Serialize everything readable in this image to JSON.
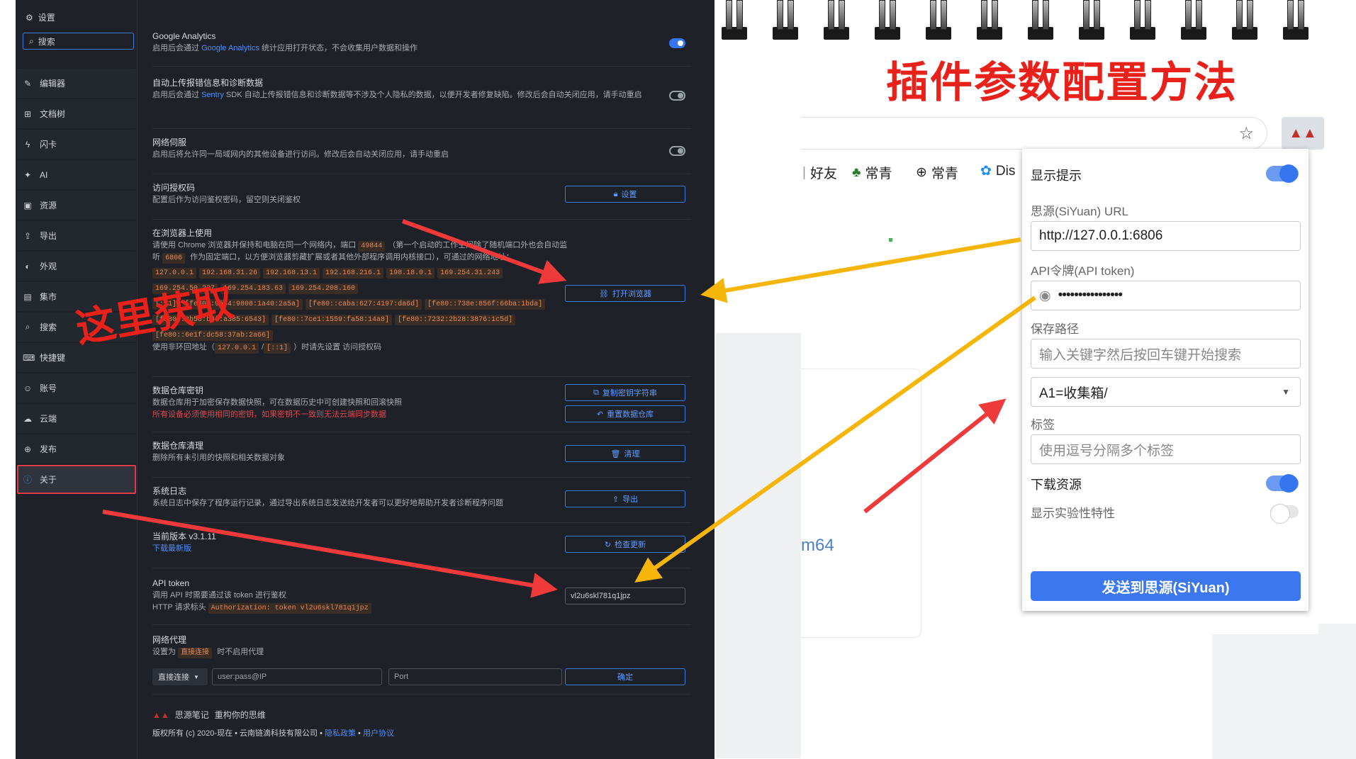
{
  "sidebar": {
    "title": "设置",
    "search_placeholder": "搜索",
    "items": [
      {
        "label": "编辑器",
        "icon": "pencil-icon"
      },
      {
        "label": "文档树",
        "icon": "tree-icon"
      },
      {
        "label": "闪卡",
        "icon": "bolt-icon"
      },
      {
        "label": "AI",
        "icon": "sparkle-icon"
      },
      {
        "label": "资源",
        "icon": "image-icon"
      },
      {
        "label": "导出",
        "icon": "upload-icon"
      },
      {
        "label": "外观",
        "icon": "palette-icon"
      },
      {
        "label": "集市",
        "icon": "store-icon"
      },
      {
        "label": "搜索",
        "icon": "search-icon"
      },
      {
        "label": "快捷键",
        "icon": "keyboard-icon"
      },
      {
        "label": "账号",
        "icon": "user-icon"
      },
      {
        "label": "云端",
        "icon": "cloud-icon"
      },
      {
        "label": "发布",
        "icon": "globe-icon"
      },
      {
        "label": "关于",
        "icon": "info-icon",
        "active": true
      }
    ]
  },
  "settings": {
    "analytics": {
      "title": "Google Analytics",
      "desc_a": "启用后会通过 ",
      "desc_link": "Google Analytics",
      "desc_b": " 统计应用打开状态，不会收集用户数据和操作",
      "enabled": true
    },
    "diagnostics": {
      "title": "自动上传报错信息和诊断数据",
      "desc_a": "启用后会通过 ",
      "desc_link": "Sentry",
      "desc_b": " SDK 自动上传报错信息和诊断数据等不涉及个人隐私的数据，以便开发者修复缺陷。修改后会自动关闭应用，请手动重启",
      "enabled": false
    },
    "network_serve": {
      "title": "网络伺服",
      "desc": "启用后将允许同一局域网内的其他设备进行访问。修改后会自动关闭应用，请手动重启",
      "enabled": false
    },
    "access_code": {
      "title": "访问授权码",
      "desc": "配置后作为访问鉴权密码，留空则关闭鉴权",
      "button": "设置"
    },
    "browser": {
      "title": "在浏览器上使用",
      "desc_a": "请使用 Chrome 浏览器并保持和电脑在同一个网络内，端口 ",
      "port_random": "49844",
      "desc_b": "（第一个启动的工作空间除了随机端口外也会自动监听 ",
      "port_fixed": "6806",
      "desc_c": " 作为固定端口，以方便浏览器剪藏扩展或者其他外部程序调用内核接口），可通过的网络地址：",
      "ips_line1": [
        "127.0.0.1",
        "192.168.31.26",
        "192.168.13.1",
        "192.168.216.1",
        "198.18.0.1",
        "169.254.31.243"
      ],
      "ips_line2": [
        "169.254.50.227",
        "169.254.183.63",
        "169.254.208.160"
      ],
      "ips_line3": [
        "[::1]",
        "[fe80::9564:9808:1a40:2a5a]",
        "[fe80::caba:627:4197:da6d]",
        "[fe80::738e:856f:66ba:1bda]"
      ],
      "ips_line4": [
        "[fe80::8b58:b4f:a385:6543]",
        "[fe80::7ce1:1559:fa58:14a8]",
        "[fe80::7232:2b28:3876:1c5d]"
      ],
      "ips_line5": [
        "[fe80::6e1f:dc58:37ab:2a66]"
      ],
      "loop_a": "使用非环回地址（",
      "loop_ip1": "127.0.0.1",
      "loop_sep": "/",
      "loop_ip2": "[::1]",
      "loop_b": "）时请先设置 访问授权码",
      "button": "打开浏览器"
    },
    "repo_key": {
      "title": "数据仓库密钥",
      "desc": "数据仓库用于加密保存数据快照，可在数据历史中可创建快照和回滚快照",
      "warn": "所有设备必须使用相同的密钥，如果密钥不一致则无法云端同步数据",
      "button1": "复制密钥字符串",
      "button2": "重置数据仓库"
    },
    "repo_clean": {
      "title": "数据仓库清理",
      "desc": "删除所有未引用的快照和相关数据对象",
      "button": "清理"
    },
    "syslog": {
      "title": "系统日志",
      "desc": "系统日志中保存了程序运行记录，通过导出系统日志发送给开发者可以更好地帮助开发者诊断程序问题",
      "button": "导出"
    },
    "version": {
      "title": "当前版本 v3.1.11",
      "link": "下载最新版",
      "button": "检查更新"
    },
    "api_token": {
      "title": "API token",
      "desc": "调用 API 时需要通过该 token 进行鉴权",
      "header_label": "HTTP 请求标头 ",
      "header_value": "Authorization: token vl2u6skl781q1jpz",
      "value": "vl2u6skl781q1jpz"
    },
    "proxy": {
      "title": "网络代理",
      "desc_a": "设置为 ",
      "desc_chip": "直接连接",
      "desc_b": " 时不启用代理",
      "select": "直接连接",
      "user_placeholder": "user:pass@IP",
      "port_placeholder": "Port",
      "button": "确定"
    },
    "footer": {
      "brand": "思源笔记",
      "slogan": "重构你的思维",
      "copyright": "版权所有 (c) 2020-现在 • 云南链滴科技有限公司 • ",
      "privacy": "隐私政策",
      "dot": " • ",
      "agreement": "用户协议"
    }
  },
  "right": {
    "title": "插件参数配置方法",
    "annotation": "这里获取",
    "bookmarks": [
      {
        "label": "好友",
        "icon": "separator-icon"
      },
      {
        "label": "常青",
        "icon": "tree-figure-icon"
      },
      {
        "label": "常青",
        "icon": "globe-icon"
      },
      {
        "label": "Dis",
        "icon": "butterfly-icon"
      }
    ],
    "ghost_text": "m64",
    "popup": {
      "show_tips_label": "显示提示",
      "show_tips_on": true,
      "url_label": "思源(SiYuan) URL",
      "url_value": "http://127.0.0.1:6806",
      "token_label": "API令牌(API token)",
      "token_value": "••••••••••••••••",
      "save_path_label": "保存路径",
      "save_path_placeholder": "输入关键字然后按回车键开始搜索",
      "notebook_value": "A1=收集箱/",
      "tags_label": "标签",
      "tags_placeholder": "使用逗号分隔多个标签",
      "download_label": "下载资源",
      "download_on": true,
      "experimental_label": "显示实验性特性",
      "experimental_on": false,
      "send_button": "发送到思源(SiYuan)"
    }
  },
  "colors": {
    "accent": "#3575f0",
    "annotation_red": "#e8211b",
    "arrow_red": "#ee3a3a",
    "arrow_yellow": "#f6b50a",
    "dark_bg": "#1e2127"
  }
}
